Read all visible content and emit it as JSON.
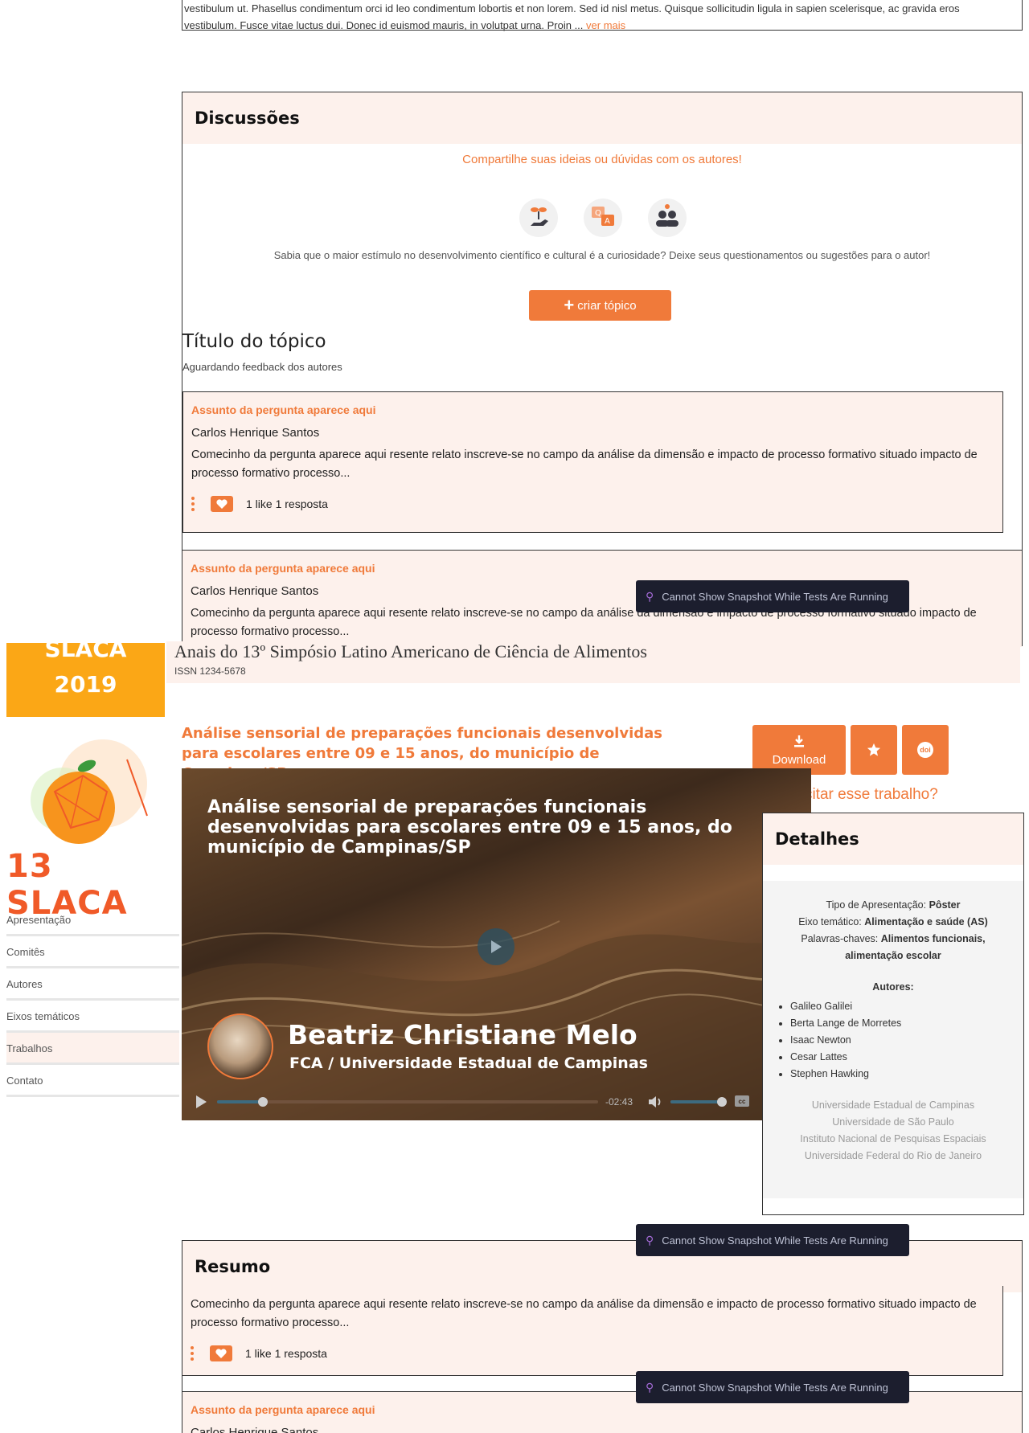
{
  "top_excerpt": {
    "line1": "vestibulum ut. Phasellus condimentum orci id leo condimentum lobortis et non lorem. Sed id nisl metus. Quisque sollicitudin ligula in sapien scelerisque, ac gravida eros",
    "line2": "vestibulum. Fusce vitae luctus dui. Donec id euismod mauris, in volutpat urna. Proin ...",
    "more_link": "ver mais"
  },
  "discussions": {
    "title": "Discussões",
    "subtitle": "Compartilhe suas ideias ou dúvidas com os autores!",
    "hint": "Sabia que o maior estímulo no desenvolvimento científico e cultural é a curiosidade? Deixe seus questionamentos ou sugestões para o autor!",
    "create_button": "criar tópico",
    "create_icon": "plus-icon",
    "topic_title": "Título do tópico",
    "topic_status": "Aguardando feedback dos autores",
    "questions": [
      {
        "subject": "Assunto da pergunta aparece aqui",
        "author": "Carlos Henrique Santos",
        "body": "Comecinho da pergunta aparece aqui resente relato inscreve-se no campo da análise da dimensão e impacto de processo formativo situado impacto de processo formativo processo...",
        "stats": "1 like 1 resposta"
      },
      {
        "subject": "Assunto da pergunta aparece aqui",
        "author": "Carlos Henrique Santos",
        "body": "Comecinho da pergunta aparece aqui resente relato inscreve-se no campo da análise da dimensão e impacto de processo formativo situado impacto de processo formativo processo..."
      }
    ]
  },
  "tooltips": {
    "snapshot": "Cannot Show Snapshot While Tests Are Running"
  },
  "header": {
    "brand_line1": "SLACA",
    "brand_line2": "2019",
    "event_title": "Anais do 13º Simpósio Latino Americano de Ciência de Alimentos",
    "issn": "ISSN 1234-5678"
  },
  "logo": {
    "text": "13 SLACA"
  },
  "nav": {
    "items": [
      {
        "label": "Apresentação"
      },
      {
        "label": "Comitês"
      },
      {
        "label": "Autores"
      },
      {
        "label": "Eixos temáticos"
      },
      {
        "label": "Trabalhos"
      },
      {
        "label": "Contato"
      }
    ],
    "active_index": 4
  },
  "paper": {
    "title": "Análise sensorial de preparações funcionais desenvolvidas para escolares entre 09 e 15 anos, do município de Campinas/SP",
    "download_label": "Download",
    "download_icon": "download-icon",
    "star_icon": "star-icon",
    "doi_icon": "doi-icon",
    "cite_link": "Como citar esse trabalho?"
  },
  "video": {
    "overlay_title": "Análise sensorial de preparações funcionais desenvolvidas para escolares entre 09 e 15 anos, do município de Campinas/SP",
    "presenter": "Beatriz Christiane Melo",
    "affiliation": "FCA / Universidade Estadual de Campinas",
    "time_remaining": "-02:43",
    "progress": 0.12,
    "volume": 1.0,
    "play_icon": "play-icon",
    "volume_icon": "volume-icon",
    "cc_icon": "cc-icon"
  },
  "details": {
    "title": "Detalhes",
    "rows": [
      {
        "label": "Tipo de Apresentação: ",
        "value": "Pôster"
      },
      {
        "label": "Eixo temático: ",
        "value": "Alimentação e saúde (AS)"
      },
      {
        "label": "Palavras-chaves: ",
        "value": "Alimentos funcionais, alimentação escolar"
      }
    ],
    "authors_label": "Autores:",
    "authors": [
      "Galileo Galilei",
      "Berta Lange de Morretes",
      "Isaac Newton",
      "Cesar Lattes",
      "Stephen Hawking"
    ],
    "institutions": [
      "Universidade Estadual de Campinas",
      "Universidade de São Paulo",
      "Instituto Nacional de Pesquisas Espaciais",
      "Universidade Federal do Rio de Janeiro"
    ]
  },
  "summary": {
    "title": "Resumo",
    "body": "Comecinho da pergunta aparece aqui resente relato inscreve-se no campo da análise da dimensão e impacto de processo formativo situado impacto de processo formativo processo...",
    "stats": "1 like 1 resposta",
    "next_subject": "Assunto da pergunta aparece aqui",
    "next_author": "Carlos Henrique Santos"
  },
  "colors": {
    "accent": "#f07a3a",
    "brand_yellow": "#fba716",
    "peach": "#fdf1ec",
    "tooltip_bg": "#1c1e2e"
  }
}
